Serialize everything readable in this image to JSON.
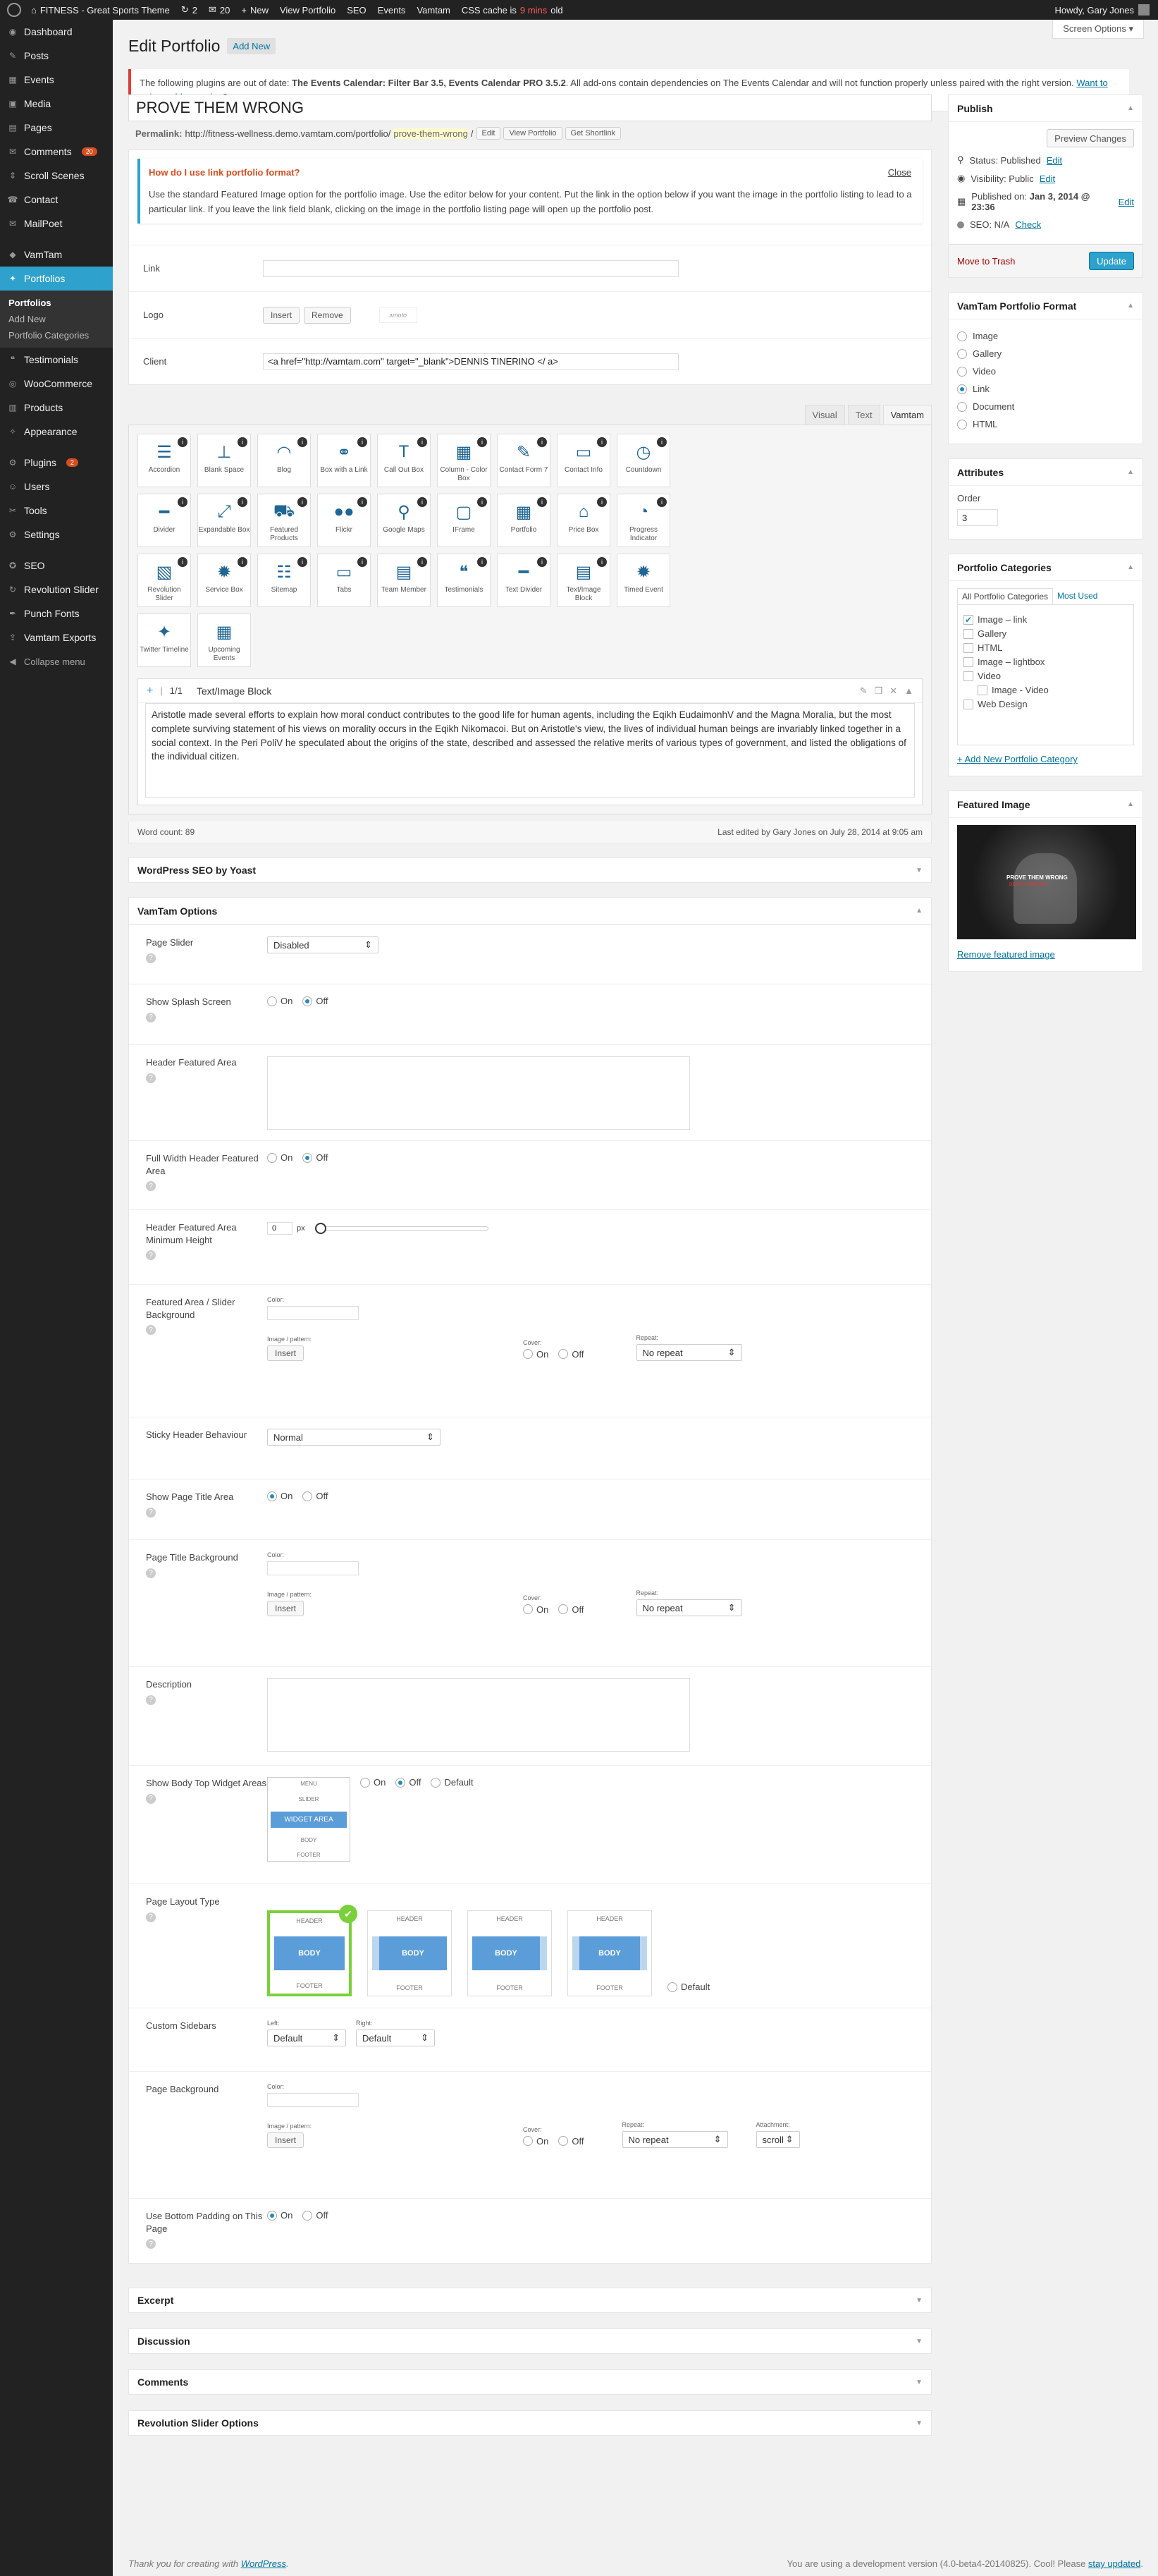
{
  "adminbar": {
    "site_name": "FITNESS - Great Sports Theme",
    "updates": "2",
    "comments": "20",
    "new": "New",
    "view_portfolio": "View Portfolio",
    "seo": "SEO",
    "events": "Events",
    "vamtam": "Vamtam",
    "css_cache_prefix": "CSS cache is",
    "css_cache_age": "9 mins",
    "css_cache_suffix": "old",
    "howdy": "Howdy, Gary Jones"
  },
  "screen_options": "Screen Options",
  "sidebar": {
    "items": [
      {
        "label": "Dashboard",
        "icon": "dashboard-icon",
        "glyph": "◉"
      },
      {
        "label": "Posts",
        "icon": "pin-icon",
        "glyph": "✎"
      },
      {
        "label": "Events",
        "icon": "calendar-icon",
        "glyph": "▦"
      },
      {
        "label": "Media",
        "icon": "media-icon",
        "glyph": "▣"
      },
      {
        "label": "Pages",
        "icon": "pages-icon",
        "glyph": "▤"
      },
      {
        "label": "Comments",
        "icon": "comment-icon",
        "glyph": "✉",
        "badge": "20"
      },
      {
        "label": "Scroll Scenes",
        "icon": "scroll-icon",
        "glyph": "⇕"
      },
      {
        "label": "Contact",
        "icon": "contact-icon",
        "glyph": "☎"
      },
      {
        "label": "MailPoet",
        "icon": "mail-icon",
        "glyph": "✉"
      }
    ],
    "items2": [
      {
        "label": "VamTam",
        "icon": "vamtam-icon",
        "glyph": "◆"
      },
      {
        "label": "Portfolios",
        "icon": "portfolio-icon",
        "glyph": "✦"
      }
    ],
    "submenu": [
      "Portfolios",
      "Add New",
      "Portfolio Categories"
    ],
    "items3": [
      {
        "label": "Testimonials",
        "icon": "quote-icon",
        "glyph": "❝"
      },
      {
        "label": "WooCommerce",
        "icon": "woocommerce-icon",
        "glyph": "◎"
      },
      {
        "label": "Products",
        "icon": "products-icon",
        "glyph": "▥"
      },
      {
        "label": "Appearance",
        "icon": "appearance-icon",
        "glyph": "✧"
      },
      {
        "label": "Plugins",
        "icon": "plugin-icon",
        "glyph": "⚙",
        "badge": "2"
      },
      {
        "label": "Users",
        "icon": "users-icon",
        "glyph": "☺"
      },
      {
        "label": "Tools",
        "icon": "tools-icon",
        "glyph": "✂"
      },
      {
        "label": "Settings",
        "icon": "settings-icon",
        "glyph": "⚙"
      },
      {
        "label": "SEO",
        "icon": "seo-icon",
        "glyph": "✪"
      },
      {
        "label": "Revolution Slider",
        "icon": "refresh-icon",
        "glyph": "↻"
      },
      {
        "label": "Punch Fonts",
        "icon": "fonts-icon",
        "glyph": "✒"
      },
      {
        "label": "Vamtam Exports",
        "icon": "export-icon",
        "glyph": "⇪"
      }
    ],
    "collapse": "Collapse menu"
  },
  "page": {
    "title": "Edit Portfolio",
    "add_new": "Add New"
  },
  "notice": {
    "text1": "The following plugins are out of date: ",
    "bold": "The Events Calendar: Filter Bar 3.5, Events Calendar PRO 3.5.2",
    "text2": ". All add-ons contain dependencies on The Events Calendar and will not function properly unless paired with the right version. ",
    "link": "Want to pair an older version",
    "end": "?"
  },
  "post": {
    "title": "PROVE THEM WRONG",
    "permalink_label": "Permalink:",
    "permalink_base": "http://fitness-wellness.demo.vamtam.com/portfolio/",
    "permalink_slug": "prove-them-wrong",
    "permalink_end": "/",
    "btn_edit": "Edit",
    "btn_view": "View Portfolio",
    "btn_shortlink": "Get Shortlink"
  },
  "help_box": {
    "title": "How do I use link portfolio format?",
    "close": "Close",
    "text": "Use the standard Featured Image option for the portfolio image. Use the editor below for your content. Put the link in the option below if you want the image in the portfolio listing to lead to a particular link. If you leave the link field blank, clicking on the image in the portfolio listing page will open up the portfolio post."
  },
  "fields": {
    "link_label": "Link",
    "link_value": "",
    "logo_label": "Logo",
    "insert": "Insert",
    "remove": "Remove",
    "client_label": "Client",
    "client_value": "<a href=\"http://vamtam.com\" target=\"_blank\">DENNIS TINERINO </ a>"
  },
  "editor": {
    "tabs": [
      "Visual",
      "Text",
      "Vamtam"
    ],
    "shortcodes": [
      {
        "label": "Accordion",
        "glyph": "☰"
      },
      {
        "label": "Blank Space",
        "glyph": "⊥"
      },
      {
        "label": "Blog",
        "glyph": "◠"
      },
      {
        "label": "Box with a Link",
        "glyph": "⚭"
      },
      {
        "label": "Call Out Box",
        "glyph": "T"
      },
      {
        "label": "Column - Color Box",
        "glyph": "▦"
      },
      {
        "label": "Contact Form 7",
        "glyph": "✎"
      },
      {
        "label": "Contact Info",
        "glyph": "▭"
      },
      {
        "label": "Countdown",
        "glyph": "◷"
      },
      {
        "label": "Divider",
        "glyph": "━"
      },
      {
        "label": "Expandable Box",
        "glyph": "⤢"
      },
      {
        "label": "Featured Products",
        "glyph": "⛟"
      },
      {
        "label": "Flickr",
        "glyph": "●●"
      },
      {
        "label": "Google Maps",
        "glyph": "⚲"
      },
      {
        "label": "IFrame",
        "glyph": "▢"
      },
      {
        "label": "Portfolio",
        "glyph": "▦"
      },
      {
        "label": "Price Box",
        "glyph": "⌂"
      },
      {
        "label": "Progress Indicator",
        "glyph": "◔"
      },
      {
        "label": "Revolution Slider",
        "glyph": "▧"
      },
      {
        "label": "Service Box",
        "glyph": "✹"
      },
      {
        "label": "Sitemap",
        "glyph": "☷"
      },
      {
        "label": "Tabs",
        "glyph": "▭"
      },
      {
        "label": "Team Member",
        "glyph": "▤"
      },
      {
        "label": "Testimonials",
        "glyph": "❝"
      },
      {
        "label": "Text Divider",
        "glyph": "━"
      },
      {
        "label": "Text/Image Block",
        "glyph": "▤"
      },
      {
        "label": "Timed Event",
        "glyph": "✹"
      },
      {
        "label": "Twitter Timeline",
        "glyph": "✦"
      },
      {
        "label": "Upcoming Events",
        "glyph": "▦"
      }
    ],
    "block_fraction": "1/1",
    "block_title": "Text/Image Block",
    "block_content": "Aristotle made several efforts to explain how moral conduct contributes to the good life for human agents, including the Eqikh EudaimonhV and the Magna Moralia, but the most complete surviving statement of his views on morality occurs in the Eqikh Nikomacoi. But on Aristotle's view, the lives of individual human beings are invariably linked together in a social context. In the Peri PoliV he speculated about the origins of the state, described and assessed the relative merits of various types of government, and listed the obligations of the individual citizen.",
    "word_count": "Word count: 89",
    "last_edited": "Last edited by Gary Jones on July 28, 2014 at 9:05 am"
  },
  "yoast": "WordPress SEO by Yoast",
  "vamtam": {
    "title": "VamTam Options",
    "page_slider": "Page Slider",
    "page_slider_value": "Disabled",
    "splash": "Show Splash Screen",
    "on": "On",
    "off": "Off",
    "default": "Default",
    "header_featured": "Header Featured Area",
    "full_width_header": "Full Width Header Featured Area",
    "header_min_height": "Header Featured Area Minimum Height",
    "min_height_value": "0",
    "px": "px",
    "featured_bg": "Featured Area / Slider Background",
    "color": "Color:",
    "image_pattern": "Image / pattern:",
    "cover": "Cover:",
    "repeat": "Repeat:",
    "no_repeat": "No repeat",
    "insert": "Insert",
    "sticky_header": "Sticky Header Behaviour",
    "sticky_value": "Normal",
    "show_title": "Show Page Title Area",
    "title_bg": "Page Title Background",
    "description": "Description",
    "body_top": "Show Body Top Widget Areas",
    "widget_labels": [
      "MENU",
      "SLIDER",
      "WIDGET AREA",
      "BODY",
      "FOOTER"
    ],
    "layout_type": "Page Layout Type",
    "layout_header": "HEADER",
    "layout_body": "BODY",
    "layout_footer": "FOOTER",
    "custom_sidebars": "Custom Sidebars",
    "left": "Left:",
    "right": "Right:",
    "default_value": "Default",
    "page_bg": "Page Background",
    "attachment": "Attachment:",
    "scroll": "scroll",
    "bottom_padding": "Use Bottom Padding on This Page"
  },
  "collapsed_boxes": [
    "Excerpt",
    "Discussion",
    "Comments",
    "Revolution Slider Options"
  ],
  "publish": {
    "title": "Publish",
    "preview": "Preview Changes",
    "status": "Status: Published",
    "visibility": "Visibility: Public",
    "published_on_label": "Published on: ",
    "published_on": "Jan 3, 2014 @ 23:36",
    "seo": "SEO: N/A",
    "check": "Check",
    "edit": "Edit",
    "trash": "Move to Trash",
    "update": "Update"
  },
  "format": {
    "title": "VamTam Portfolio Format",
    "options": [
      "Image",
      "Gallery",
      "Video",
      "Link",
      "Document",
      "HTML"
    ],
    "selected": 3
  },
  "attributes": {
    "title": "Attributes",
    "order_label": "Order",
    "order_value": "3"
  },
  "categories": {
    "title": "Portfolio Categories",
    "tab_all": "All Portfolio Categories",
    "tab_used": "Most Used",
    "items": [
      {
        "label": "Image – link",
        "checked": true,
        "indent": false
      },
      {
        "label": "Gallery",
        "checked": false,
        "indent": false
      },
      {
        "label": "HTML",
        "checked": false,
        "indent": false
      },
      {
        "label": "Image – lightbox",
        "checked": false,
        "indent": false
      },
      {
        "label": "Video",
        "checked": false,
        "indent": false
      },
      {
        "label": "Image - Video",
        "checked": false,
        "indent": true
      },
      {
        "label": "Web Design",
        "checked": false,
        "indent": false
      }
    ],
    "add_new": "+ Add New Portfolio Category"
  },
  "featured_image": {
    "title": "Featured Image",
    "remove": "Remove featured image",
    "overlay_title": "PROVE THEM WRONG",
    "overlay_sub": "DENNIS TINERINO"
  },
  "footer": {
    "thanks_prefix": "Thank you for creating with ",
    "wordpress": "WordPress",
    "thanks_suffix": ".",
    "version_text": "You are using a development version (4.0-beta4-20140825). Cool! Please ",
    "stay_updated": "stay updated",
    "version_end": "."
  },
  "colors": {
    "accent": "#2ea2cc",
    "adminbar": "#222222",
    "notice_border": "#dd3d36",
    "help_title": "#d54e21",
    "selected_layout": "#7ad03a"
  }
}
